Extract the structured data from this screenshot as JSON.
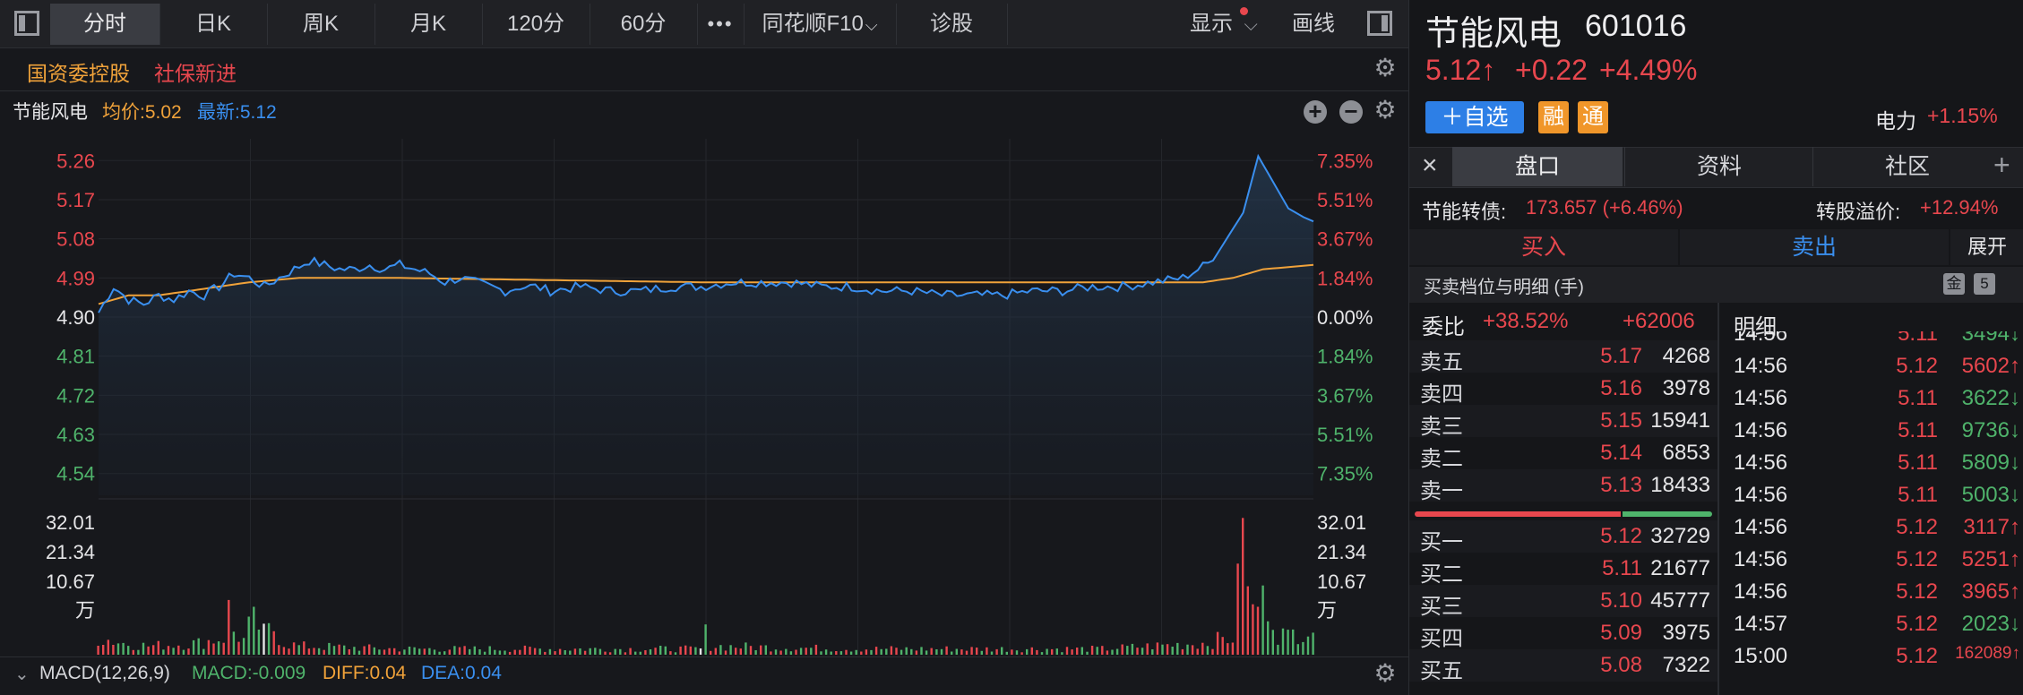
{
  "toolbar": {
    "tabs": [
      "分时",
      "日K",
      "周K",
      "月K",
      "120分",
      "60分",
      "•••",
      "同花顺F10",
      "诊股"
    ],
    "display_label": "显示",
    "draw_label": "画线"
  },
  "tags": [
    "国资委控股",
    "社保新进"
  ],
  "chart_header": {
    "name": "节能风电",
    "avg": "均价:5.02",
    "latest": "最新:5.12"
  },
  "macd_bar": {
    "name": "MACD(12,26,9)",
    "macd": "MACD:-0.009",
    "diff": "DIFF:0.04",
    "dea": "DEA:0.04"
  },
  "chart_data": {
    "type": "line",
    "ylim": [
      4.49,
      5.31
    ],
    "price_ticks_left": [
      {
        "v": 5.26,
        "label": "5.26",
        "color": "red"
      },
      {
        "v": 5.17,
        "label": "5.17",
        "color": "red"
      },
      {
        "v": 5.08,
        "label": "5.08",
        "color": "red"
      },
      {
        "v": 4.99,
        "label": "4.99",
        "color": "red"
      },
      {
        "v": 4.9,
        "label": "4.90",
        "color": "white"
      },
      {
        "v": 4.81,
        "label": "4.81",
        "color": "green"
      },
      {
        "v": 4.72,
        "label": "4.72",
        "color": "green"
      },
      {
        "v": 4.63,
        "label": "4.63",
        "color": "green"
      },
      {
        "v": 4.54,
        "label": "4.54",
        "color": "green"
      }
    ],
    "pct_ticks_right": [
      {
        "v": 5.26,
        "label": "7.35%",
        "color": "red"
      },
      {
        "v": 5.17,
        "label": "5.51%",
        "color": "red"
      },
      {
        "v": 5.08,
        "label": "3.67%",
        "color": "red"
      },
      {
        "v": 4.99,
        "label": "1.84%",
        "color": "red"
      },
      {
        "v": 4.9,
        "label": "0.00%",
        "color": "white"
      },
      {
        "v": 4.81,
        "label": "1.84%",
        "color": "green"
      },
      {
        "v": 4.72,
        "label": "3.67%",
        "color": "green"
      },
      {
        "v": 4.63,
        "label": "5.51%",
        "color": "green"
      },
      {
        "v": 4.54,
        "label": "7.35%",
        "color": "green"
      }
    ],
    "volume_ticks": [
      "32.01",
      "21.34",
      "10.67",
      "万"
    ],
    "volume_ylim": [
      0,
      44
    ],
    "price_anchors": [
      [
        0,
        4.91
      ],
      [
        3,
        4.97
      ],
      [
        6,
        4.94
      ],
      [
        9,
        4.93
      ],
      [
        12,
        4.95
      ],
      [
        15,
        4.94
      ],
      [
        18,
        4.96
      ],
      [
        21,
        4.95
      ],
      [
        24,
        4.97
      ],
      [
        27,
        5.0
      ],
      [
        30,
        4.99
      ],
      [
        33,
        4.97
      ],
      [
        36,
        4.99
      ],
      [
        39,
        5.01
      ],
      [
        42,
        5.03
      ],
      [
        45,
        5.02
      ],
      [
        48,
        5.01
      ],
      [
        51,
        5.01
      ],
      [
        54,
        5.02
      ],
      [
        57,
        5.01
      ],
      [
        60,
        5.02
      ],
      [
        63,
        5.01
      ],
      [
        66,
        5.0
      ],
      [
        69,
        4.98
      ],
      [
        72,
        4.99
      ],
      [
        75,
        4.98
      ],
      [
        78,
        4.97
      ],
      [
        81,
        4.96
      ],
      [
        84,
        4.97
      ],
      [
        87,
        4.97
      ],
      [
        90,
        4.96
      ],
      [
        96,
        4.97
      ],
      [
        102,
        4.96
      ],
      [
        108,
        4.96
      ],
      [
        114,
        4.97
      ],
      [
        120,
        4.97
      ],
      [
        126,
        4.98
      ],
      [
        132,
        4.98
      ],
      [
        138,
        4.98
      ],
      [
        144,
        4.97
      ],
      [
        150,
        4.97
      ],
      [
        156,
        4.96
      ],
      [
        162,
        4.96
      ],
      [
        168,
        4.95
      ],
      [
        174,
        4.95
      ],
      [
        180,
        4.95
      ],
      [
        186,
        4.96
      ],
      [
        192,
        4.96
      ],
      [
        198,
        4.97
      ],
      [
        204,
        4.97
      ],
      [
        210,
        4.98
      ],
      [
        216,
        4.99
      ],
      [
        222,
        5.03
      ],
      [
        228,
        5.14
      ],
      [
        231,
        5.27
      ],
      [
        234,
        5.21
      ],
      [
        237,
        5.15
      ],
      [
        240,
        5.13
      ],
      [
        242,
        5.12
      ]
    ],
    "avg_anchors": [
      [
        0,
        4.93
      ],
      [
        6,
        4.95
      ],
      [
        12,
        4.95
      ],
      [
        18,
        4.96
      ],
      [
        24,
        4.97
      ],
      [
        30,
        4.98
      ],
      [
        40,
        4.99
      ],
      [
        60,
        4.99
      ],
      [
        120,
        4.98
      ],
      [
        180,
        4.98
      ],
      [
        210,
        4.98
      ],
      [
        220,
        4.98
      ],
      [
        226,
        4.99
      ],
      [
        232,
        5.01
      ],
      [
        242,
        5.02
      ]
    ],
    "volume_anchors": [
      [
        0,
        6
      ],
      [
        5,
        4
      ],
      [
        10,
        3
      ],
      [
        20,
        4
      ],
      [
        25,
        6
      ],
      [
        26,
        14
      ],
      [
        27,
        8
      ],
      [
        29,
        5
      ],
      [
        31,
        13
      ],
      [
        33,
        7
      ],
      [
        35,
        9
      ],
      [
        37,
        4
      ],
      [
        40,
        3
      ],
      [
        60,
        2
      ],
      [
        90,
        2
      ],
      [
        120,
        2
      ],
      [
        121,
        7
      ],
      [
        122,
        3
      ],
      [
        150,
        2
      ],
      [
        200,
        2
      ],
      [
        210,
        3
      ],
      [
        220,
        4
      ],
      [
        226,
        6
      ],
      [
        228,
        35
      ],
      [
        229,
        18
      ],
      [
        231,
        12
      ],
      [
        233,
        22
      ],
      [
        235,
        8
      ],
      [
        237,
        6
      ],
      [
        240,
        10
      ],
      [
        242,
        10
      ]
    ]
  },
  "right_panel": {
    "name": "节能风电",
    "code": "601016",
    "price": "5.12↑",
    "change": "+0.22",
    "change_pct": "+4.49%",
    "watch_btn": "＋自选",
    "badge1": "融",
    "badge2": "通",
    "sector": "电力",
    "sector_pct": "+1.15%",
    "tabs": [
      "盘口",
      "资料",
      "社区"
    ],
    "bond_label": "节能转债:",
    "bond_value": "173.657 (+6.46%)",
    "premium_label": "转股溢价:",
    "premium_value": "+12.94%",
    "buy_label": "买入",
    "sell_label": "卖出",
    "expand_label": "展开",
    "orderbook_title": "买卖档位与明细 (手)",
    "gold_badge": "金",
    "five_badge": "5",
    "weibi_label": "委比",
    "weibi_pct": "+38.52%",
    "weibi_vol": "+62006",
    "detail_label": "明细",
    "asks": [
      {
        "label": "卖五",
        "price": "5.17",
        "vol": "4268"
      },
      {
        "label": "卖四",
        "price": "5.16",
        "vol": "3978"
      },
      {
        "label": "卖三",
        "price": "5.15",
        "vol": "15941"
      },
      {
        "label": "卖二",
        "price": "5.14",
        "vol": "6853"
      },
      {
        "label": "卖一",
        "price": "5.13",
        "vol": "18433"
      }
    ],
    "bids": [
      {
        "label": "买一",
        "price": "5.12",
        "vol": "32729"
      },
      {
        "label": "买二",
        "price": "5.11",
        "vol": "21677"
      },
      {
        "label": "买三",
        "price": "5.10",
        "vol": "45777"
      },
      {
        "label": "买四",
        "price": "5.09",
        "vol": "3975"
      },
      {
        "label": "买五",
        "price": "5.08",
        "vol": "7322"
      }
    ],
    "ticks": [
      {
        "time": "14:56",
        "price": "5.11",
        "vol": "3494↓",
        "pc": "red",
        "vc": "green"
      },
      {
        "time": "14:56",
        "price": "5.12",
        "vol": "5602↑",
        "pc": "red",
        "vc": "red"
      },
      {
        "time": "14:56",
        "price": "5.11",
        "vol": "3622↓",
        "pc": "red",
        "vc": "green"
      },
      {
        "time": "14:56",
        "price": "5.11",
        "vol": "9736↓",
        "pc": "red",
        "vc": "green"
      },
      {
        "time": "14:56",
        "price": "5.11",
        "vol": "5809↓",
        "pc": "red",
        "vc": "green"
      },
      {
        "time": "14:56",
        "price": "5.11",
        "vol": "5003↓",
        "pc": "red",
        "vc": "green"
      },
      {
        "time": "14:56",
        "price": "5.12",
        "vol": "3117↑",
        "pc": "red",
        "vc": "red"
      },
      {
        "time": "14:56",
        "price": "5.12",
        "vol": "5251↑",
        "pc": "red",
        "vc": "red"
      },
      {
        "time": "14:56",
        "price": "5.12",
        "vol": "3965↑",
        "pc": "red",
        "vc": "red"
      },
      {
        "time": "14:57",
        "price": "5.12",
        "vol": "2023↓",
        "pc": "red",
        "vc": "green"
      },
      {
        "time": "15:00",
        "price": "5.12",
        "vol": "162089↑",
        "pc": "red",
        "vc": "red"
      }
    ],
    "colors": {
      "up": "#e8474e",
      "down": "#4fb36b",
      "avg": "#f0a23a",
      "price_line": "#3a8fef"
    }
  }
}
